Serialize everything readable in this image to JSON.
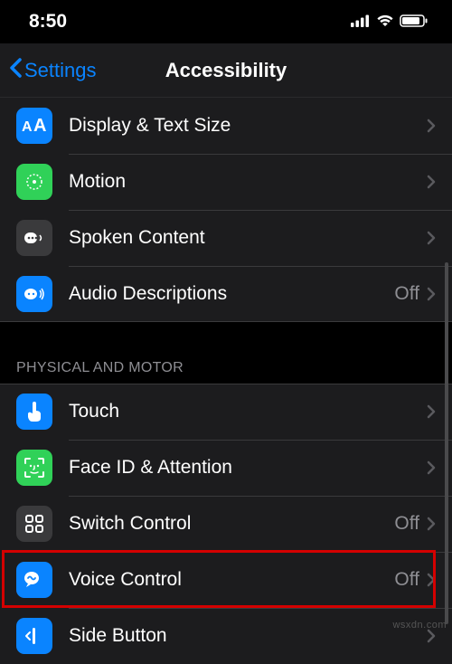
{
  "status": {
    "time": "8:50"
  },
  "nav": {
    "back": "Settings",
    "title": "Accessibility"
  },
  "section1_header": "PHYSICAL AND MOTOR",
  "rows": {
    "display_text_size": {
      "label": "Display & Text Size"
    },
    "motion": {
      "label": "Motion"
    },
    "spoken_content": {
      "label": "Spoken Content"
    },
    "audio_descriptions": {
      "label": "Audio Descriptions",
      "value": "Off"
    },
    "touch": {
      "label": "Touch"
    },
    "face_id": {
      "label": "Face ID & Attention"
    },
    "switch_control": {
      "label": "Switch Control",
      "value": "Off"
    },
    "voice_control": {
      "label": "Voice Control",
      "value": "Off"
    },
    "side_button": {
      "label": "Side Button"
    }
  },
  "watermark": "wsxdn.com"
}
